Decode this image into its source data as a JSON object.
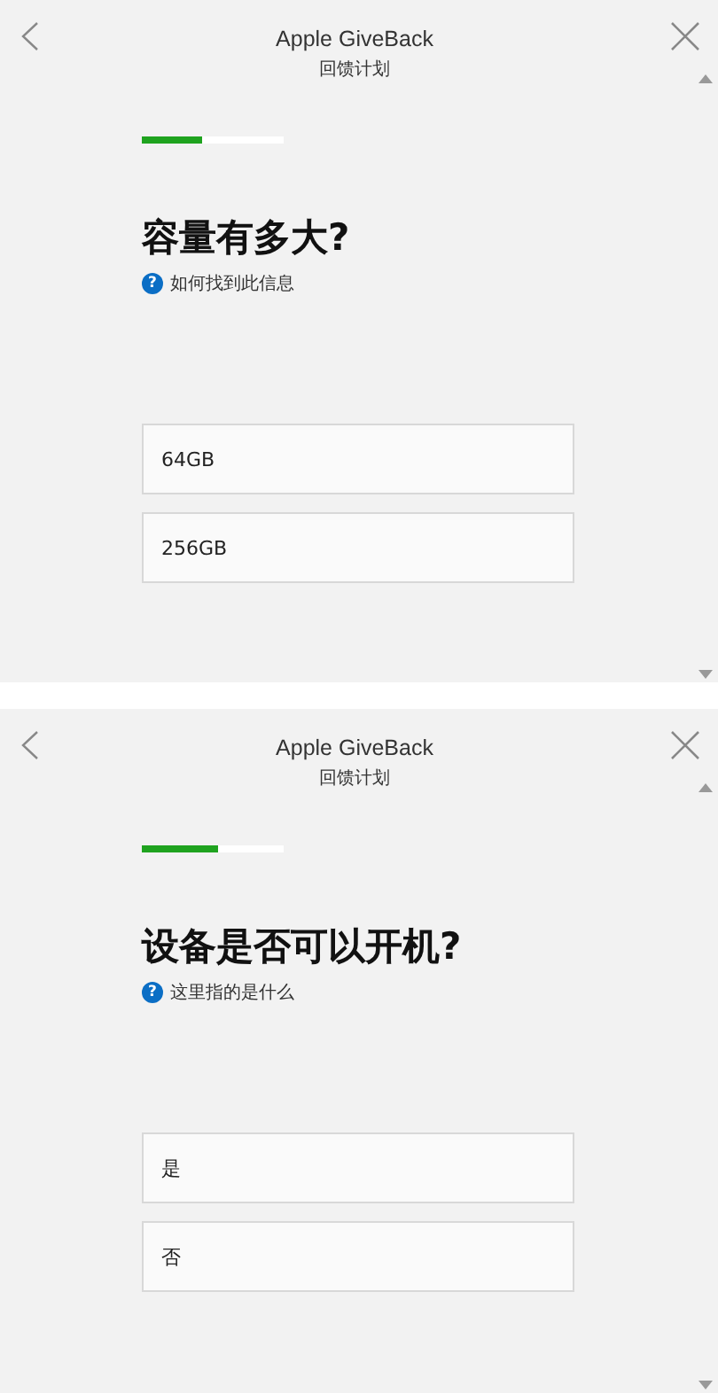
{
  "panels": [
    {
      "title": "Apple GiveBack",
      "subtitle": "回馈计划",
      "progress": {
        "level": 0.42
      },
      "question": "容量有多大?",
      "help": "如何找到此信息",
      "help_icon": "?",
      "options": [
        {
          "label": "64GB"
        },
        {
          "label": "256GB"
        }
      ]
    },
    {
      "title": "Apple GiveBack",
      "subtitle": "回馈计划",
      "progress": {
        "level": 0.54
      },
      "question": "设备是否可以开机?",
      "help": "这里指的是什么",
      "help_icon": "?",
      "options": [
        {
          "label": "是"
        },
        {
          "label": "否"
        }
      ]
    }
  ]
}
